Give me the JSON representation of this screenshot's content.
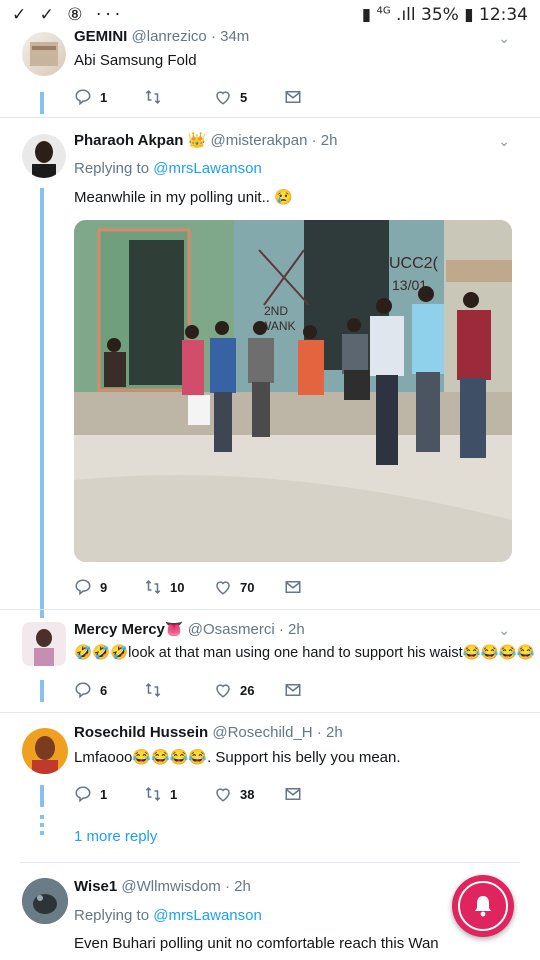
{
  "status_bar": {
    "left_icons": "✓ ✓ ⑧ ···",
    "network": "4G",
    "battery": "35%",
    "time": "12:34"
  },
  "tweets": [
    {
      "name": "GEMINI",
      "handle": "@lanrezico",
      "time": "· 34m",
      "text": "Abi Samsung Fold",
      "replies": "1",
      "retweets": "",
      "likes": "5"
    },
    {
      "name": "Pharaoh Akpan",
      "badge": "👑",
      "handle": "@misterakpan",
      "time": "· 2h",
      "replying_prefix": "Replying to",
      "replying_to": "@mrsLawanson",
      "text": "Meanwhile in my polling unit.. 😢",
      "replies": "9",
      "retweets": "10",
      "likes": "70"
    },
    {
      "name": "Mercy Mercy",
      "badge": "👅",
      "handle": "@Osasmerci",
      "time": "· 2h",
      "text": "🤣🤣🤣look at that man using one hand to support his waist😂😂😂😂",
      "replies": "6",
      "retweets": "",
      "likes": "26"
    },
    {
      "name": "Rosechild Hussein",
      "handle": "@Rosechild_H",
      "time": "· 2h",
      "text": "Lmfaooo😂😂😂😂. Support his belly you mean.",
      "replies": "1",
      "retweets": "1",
      "likes": "38"
    },
    {
      "name": "Wise1",
      "handle": "@Wllmwisdom",
      "time": "· 2h",
      "replying_prefix": "Replying to",
      "replying_to": "@mrsLawanson",
      "text": "Even Buhari polling unit no comfortable reach this Wan"
    }
  ],
  "more_replies": "1 more reply",
  "photo": {
    "wall_text_1": "UCC2(",
    "wall_text_2": "13/01",
    "wall_text_3": "2ND",
    "wall_text_4": "WANK"
  },
  "colors": {
    "accent": "#1da1f2",
    "thread": "#85c1f2",
    "fab": "#e0245e"
  }
}
